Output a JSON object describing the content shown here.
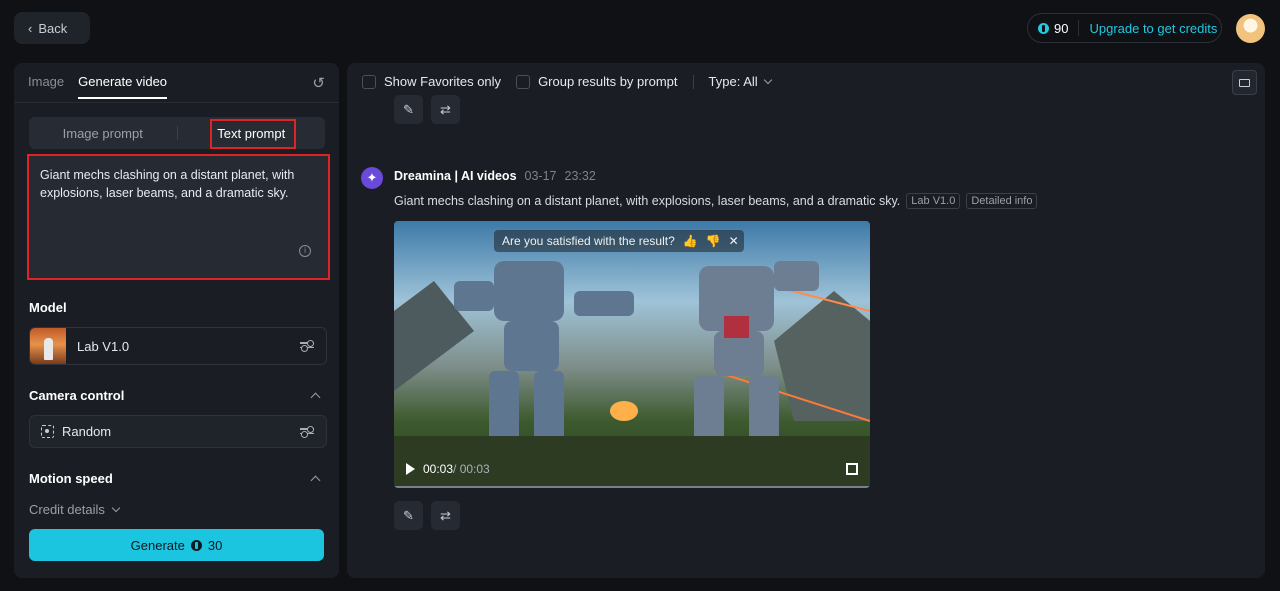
{
  "header": {
    "back_label": "Back",
    "credits": "90",
    "upgrade_label": "Upgrade to get credits"
  },
  "left": {
    "tabs": [
      {
        "label": "Image"
      },
      {
        "label": "Generate video"
      }
    ],
    "prompt_switch": [
      {
        "label": "Image prompt"
      },
      {
        "label": "Text prompt"
      }
    ],
    "prompt_text": "Giant mechs clashing on a distant planet, with explosions, laser beams, and a dramatic sky.",
    "model_label": "Model",
    "model_value": "Lab V1.0",
    "camera_label": "Camera control",
    "camera_value": "Random",
    "motion_label": "Motion speed",
    "credit_details": "Credit details",
    "generate_label": "Generate",
    "generate_cost": "30"
  },
  "right": {
    "filters": {
      "favorites": "Show Favorites only",
      "group": "Group results by prompt",
      "type": "Type: All"
    },
    "entry": {
      "source": "Dreamina | AI videos",
      "date": "03-17",
      "time": "23:32",
      "prompt": "Giant mechs clashing on a distant planet, with explosions, laser beams, and a dramatic sky.",
      "tags": [
        "Lab V1.0",
        "Detailed info"
      ]
    },
    "video": {
      "satisfaction_question": "Are you satisfied with the result?",
      "time_current": "00:03",
      "time_total": " / 00:03",
      "progress": 1.0
    }
  },
  "colors": {
    "accent": "#1cc5df",
    "highlight": "#e02424",
    "background": "#0f1115",
    "panel": "#1a1d23"
  },
  "icons": [
    "chevron-left-icon",
    "coin-icon",
    "reset-icon",
    "info-icon",
    "settings-icon",
    "chevron-up-icon",
    "focus-icon",
    "chevron-down-icon",
    "folder-icon",
    "edit-icon",
    "repeat-icon",
    "dreamina-icon",
    "thumbs-up-icon",
    "thumbs-down-icon",
    "close-icon",
    "play-icon",
    "fullscreen-icon"
  ]
}
